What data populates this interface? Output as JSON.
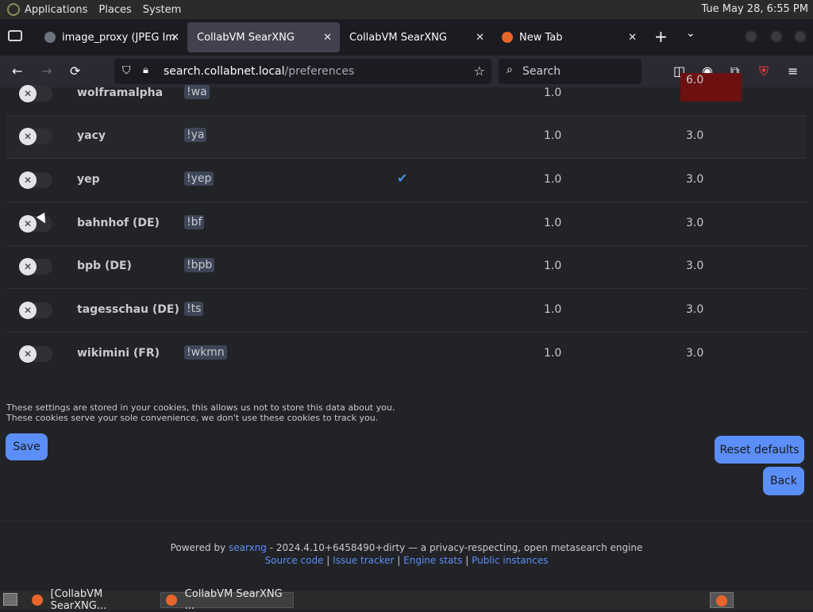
{
  "topbar": {
    "menu": [
      "Applications",
      "Places",
      "System"
    ],
    "clock": "Tue May 28,  6:55 PM"
  },
  "tabs": [
    {
      "label": "image_proxy (JPEG Im",
      "favicon": "image-icon",
      "active": false
    },
    {
      "label": "CollabVM SearXNG",
      "favicon": null,
      "active": true
    },
    {
      "label": "CollabVM SearXNG",
      "favicon": null,
      "active": false
    },
    {
      "label": "New Tab",
      "favicon": "firefox-icon",
      "active": false
    }
  ],
  "navbar": {
    "url_host": "search.collabnet.local",
    "url_path": "/preferences",
    "search_placeholder": "Search"
  },
  "engines": [
    {
      "name": "wolframalpha",
      "bang": "!wa",
      "weight": "1.0",
      "time": "6.0",
      "time_slow": true,
      "checked": false
    },
    {
      "name": "yacy",
      "bang": "!ya",
      "weight": "1.0",
      "time": "3.0",
      "time_slow": false,
      "checked": false
    },
    {
      "name": "yep",
      "bang": "!yep",
      "weight": "1.0",
      "time": "3.0",
      "time_slow": false,
      "checked": true
    },
    {
      "name": "bahnhof (DE)",
      "bang": "!bf",
      "weight": "1.0",
      "time": "3.0",
      "time_slow": false,
      "checked": false
    },
    {
      "name": "bpb (DE)",
      "bang": "!bpb",
      "weight": "1.0",
      "time": "3.0",
      "time_slow": false,
      "checked": false
    },
    {
      "name": "tagesschau (DE)",
      "bang": "!ts",
      "weight": "1.0",
      "time": "3.0",
      "time_slow": false,
      "checked": false
    },
    {
      "name": "wikimini (FR)",
      "bang": "!wkmn",
      "weight": "1.0",
      "time": "3.0",
      "time_slow": false,
      "checked": false
    }
  ],
  "cookie_notice": {
    "line1": "These settings are stored in your cookies, this allows us not to store this data about you.",
    "line2": "These cookies serve your sole convenience, we don't use these cookies to track you."
  },
  "buttons": {
    "save": "Save",
    "reset": "Reset defaults",
    "back": "Back"
  },
  "footer": {
    "powered_prefix": "Powered by",
    "powered_link": "searxng",
    "powered_suffix": "- 2024.4.10+6458490+dirty — a privacy-respecting, open metasearch engine",
    "links": [
      "Source code",
      "Issue tracker",
      "Engine stats",
      "Public instances"
    ]
  },
  "taskbar": {
    "items": [
      "[CollabVM SearXNG...",
      "CollabVM SearXNG ..."
    ]
  },
  "colors": {
    "accent": "#5b8ef7",
    "slow": "#6c1010"
  }
}
